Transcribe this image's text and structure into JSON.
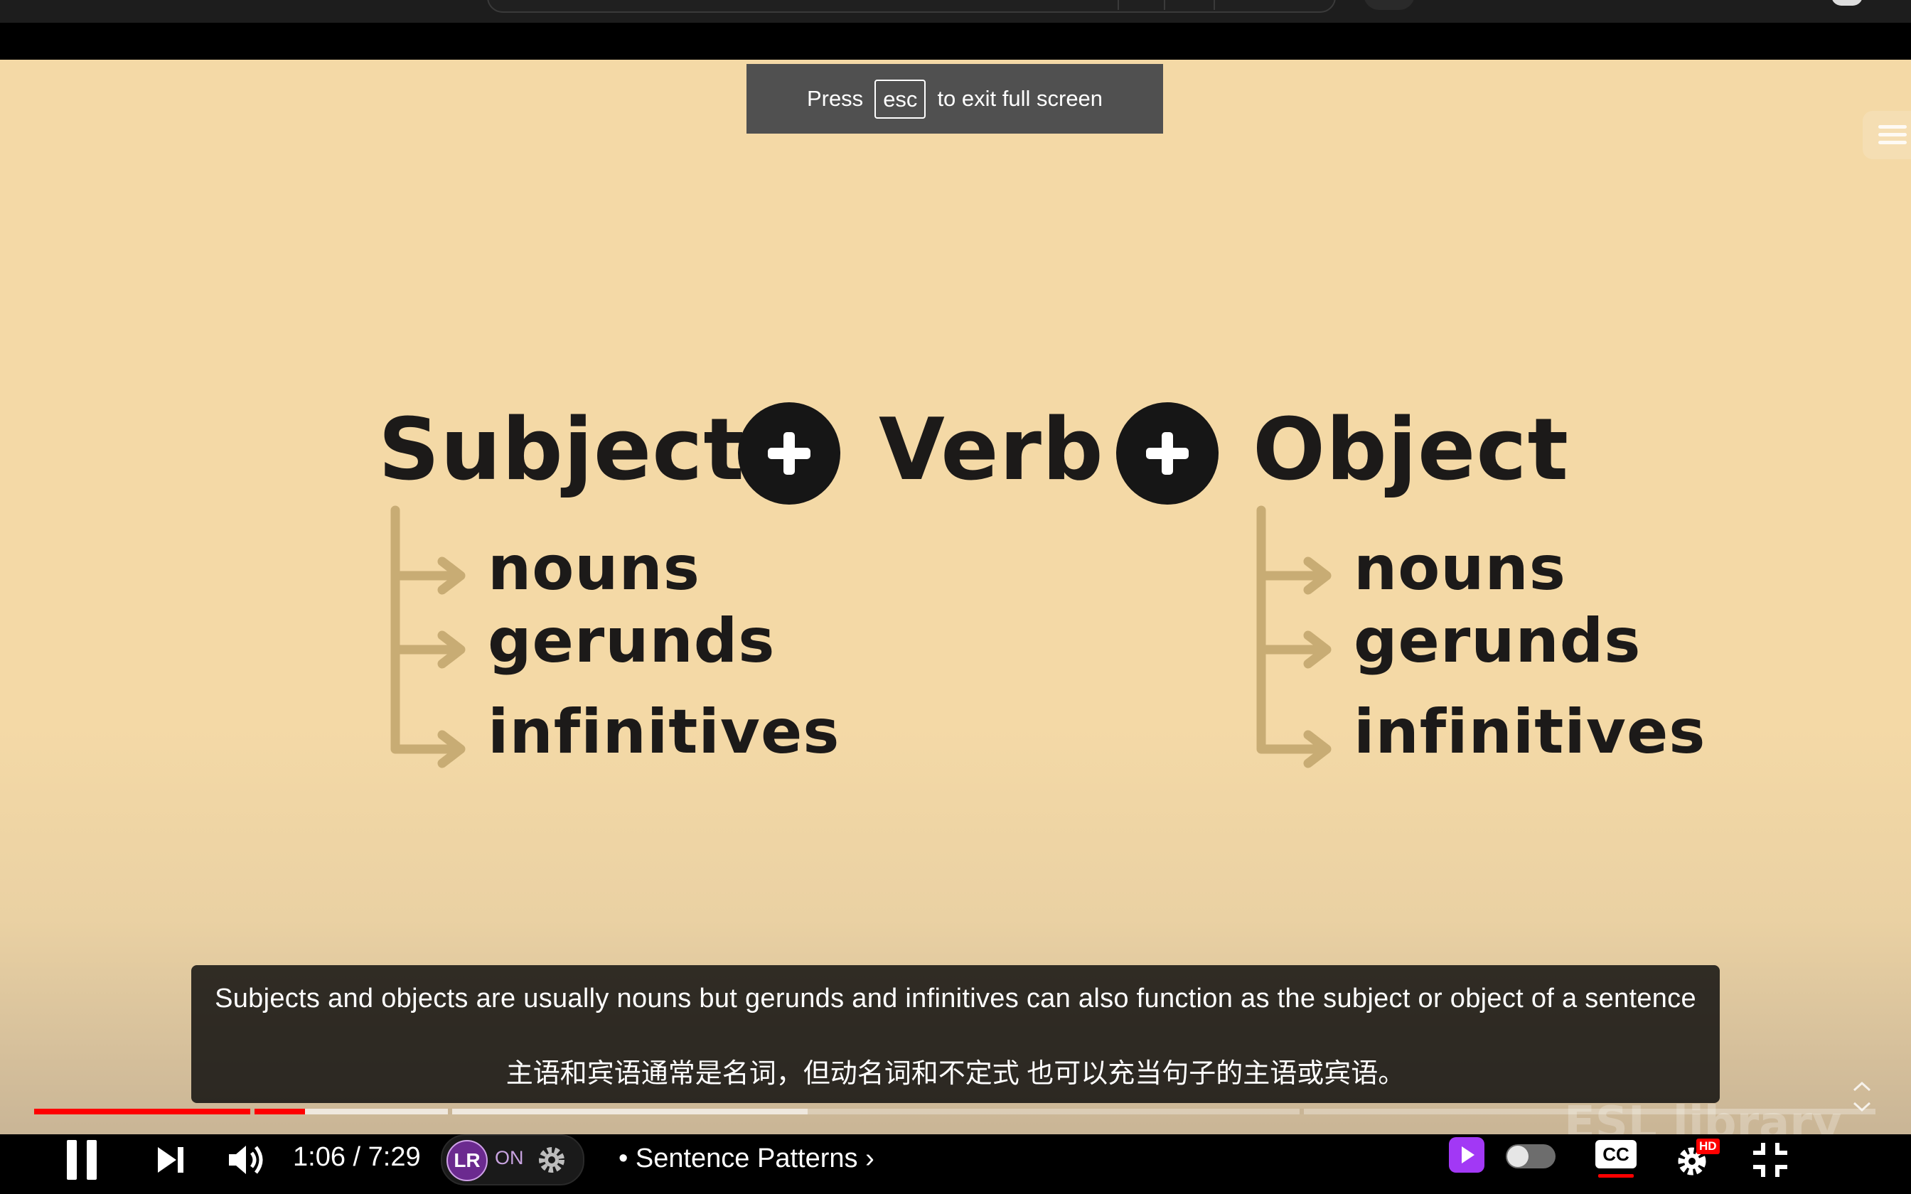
{
  "toast": {
    "prefix": "Press",
    "key": "esc",
    "suffix": "to exit full screen"
  },
  "slide": {
    "subject": "Subject",
    "verb": "Verb",
    "object": "Object",
    "subject_items": [
      "nouns",
      "gerunds",
      "infinitives"
    ],
    "object_items": [
      "nouns",
      "gerunds",
      "infinitives"
    ]
  },
  "subtitles": {
    "english": "Subjects and objects are usually nouns but gerunds and infinitives can also function as the subject or object of a sentence",
    "chinese": "主语和宾语通常是名词，但动名词和不定式 也可以充当句子的主语或宾语。"
  },
  "watermark": "ESL library",
  "progress": {
    "played_fraction": 0.147,
    "buffered_fraction": 0.42
  },
  "player": {
    "current_time": "1:06",
    "separator": "/",
    "duration": "7:29",
    "extension_label": "LR",
    "extension_status": "ON",
    "chapter": "• Sentence Patterns",
    "cc_label": "CC",
    "quality_badge": "HD"
  },
  "colors": {
    "slide_background": "#f4d9a6",
    "arrow_color": "#c8ac74",
    "progress_red": "#ff0000",
    "extension_purple": "#a238f5"
  }
}
